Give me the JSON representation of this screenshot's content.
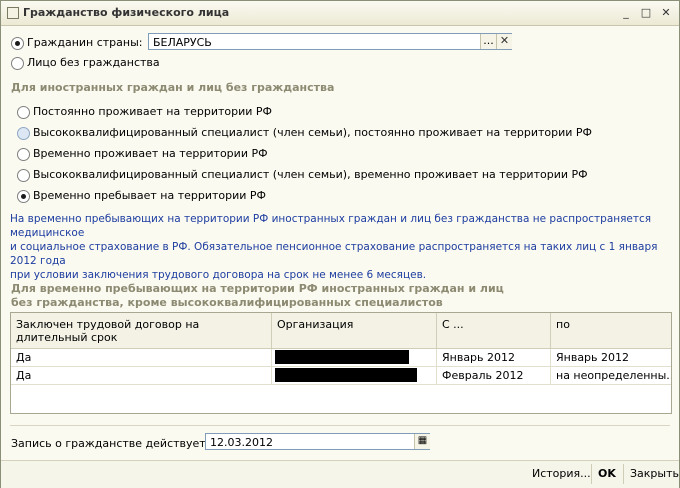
{
  "window": {
    "title": "Гражданство физического лица",
    "buttons": [
      "_",
      "□",
      "✕"
    ]
  },
  "citizenship": {
    "option_citizen": "Гражданин страны:",
    "country_value": "БЕЛАРУСЬ",
    "select_btn": "...",
    "clear_btn": "✕",
    "option_stateless": "Лицо без гражданства"
  },
  "foreign": {
    "heading": "Для иностранных граждан и лиц без гражданства",
    "options": [
      "Постоянно проживает на территории РФ",
      "Высококвалифицированный специалист (член семьи), постоянно проживает на территории РФ",
      "Временно проживает на территории РФ",
      "Высококвалифицированный специалист (член семьи), временно проживает на территории РФ",
      "Временно пребывает на территории РФ"
    ],
    "info_lines": [
      "На временно пребывающих на территории РФ иностранных граждан и лиц без гражданства не распространяется медицинское",
      "и социальное страхование в РФ. Обязательное пенсионное страхование распространяется на таких лиц с 1 января 2012 года",
      "при условии заключения трудового договора на срок не менее 6 месяцев."
    ]
  },
  "temporary": {
    "heading_line1": "Для временно пребывающих на территории РФ иностранных граждан и лиц",
    "heading_line2": "без гражданства, кроме высококвалифицированных специалистов",
    "columns": [
      "Заключен трудовой договор на длительный срок",
      "Организация",
      "С ...",
      "по"
    ],
    "rows": [
      {
        "contract": "Да",
        "from": "Январь 2012",
        "to": "Январь 2012"
      },
      {
        "contract": "Да",
        "from": "Февраль 2012",
        "to": "на неопределенны..."
      }
    ]
  },
  "record": {
    "label": "Запись о гражданстве действует с:",
    "date": "12.03.2012"
  },
  "footer": {
    "history": "История...",
    "ok": "OK",
    "close": "Закрыть"
  }
}
